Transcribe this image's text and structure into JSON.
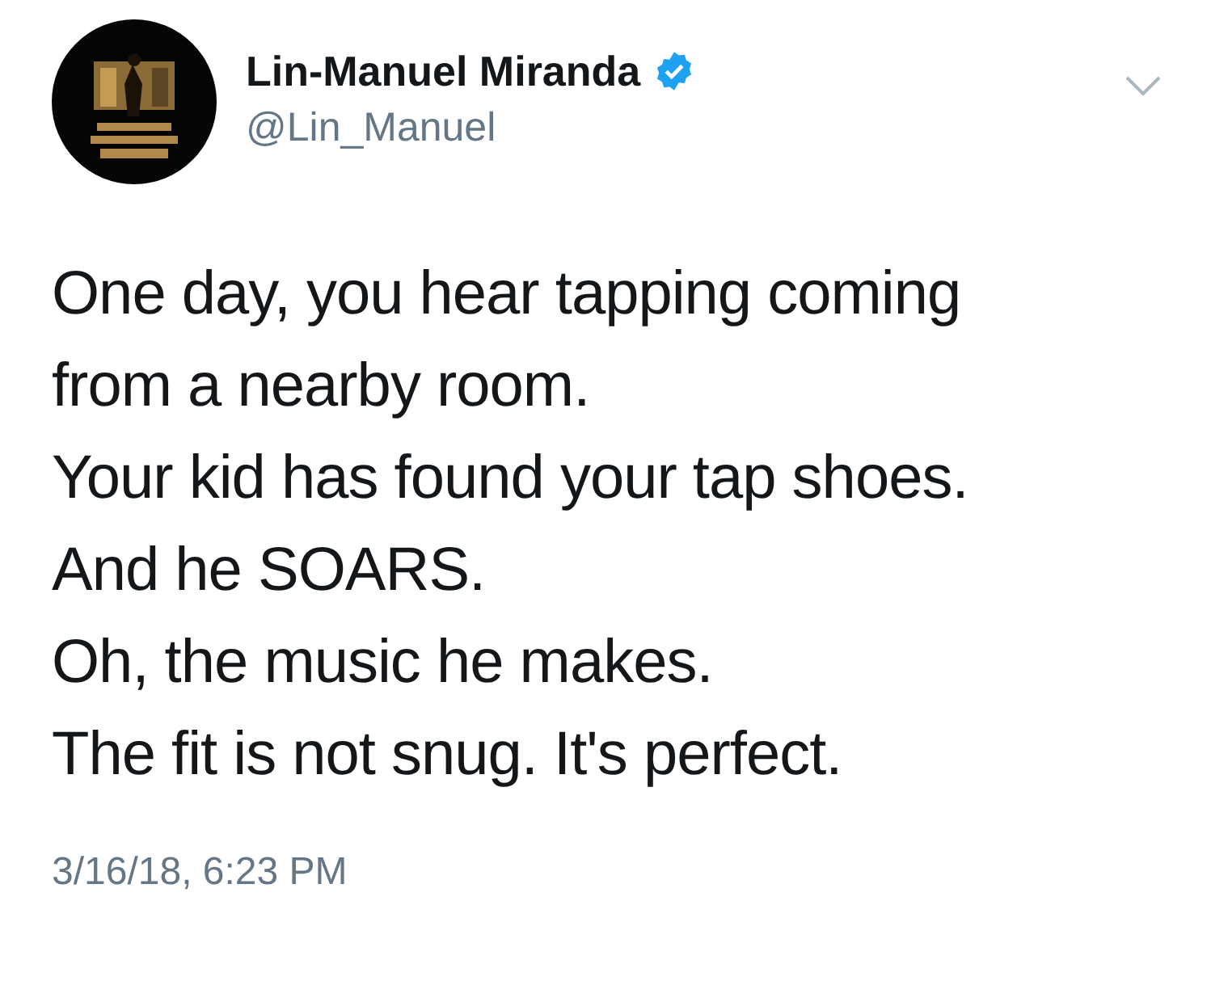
{
  "author": {
    "name": "Lin-Manuel Miranda",
    "verified": true,
    "handle": "@Lin_Manuel"
  },
  "tweet": {
    "lines": [
      "One day, you hear tapping coming from a nearby room.",
      "Your kid has found your tap shoes.",
      "And he SOARS.",
      "Oh, the music he makes.",
      "The fit is not snug. It's perfect."
    ],
    "timestamp": "3/16/18, 6:23 PM"
  }
}
